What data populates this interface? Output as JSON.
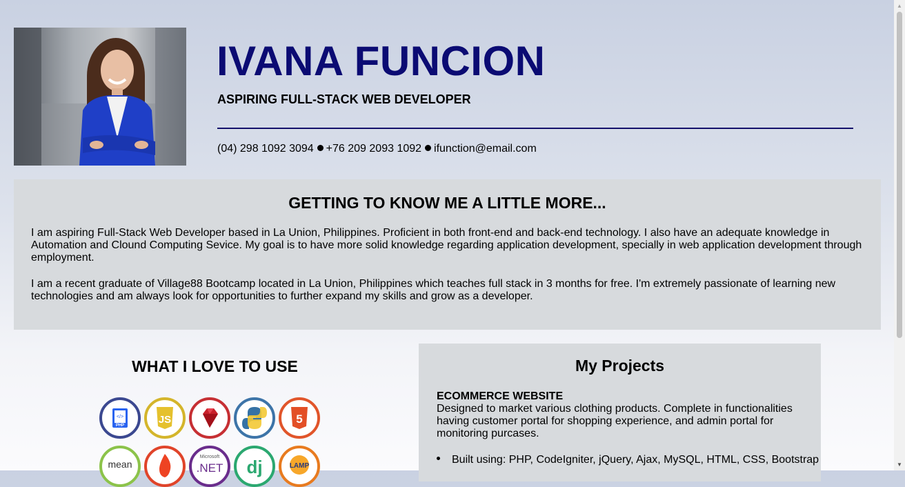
{
  "header": {
    "name": "IVANA FUNCION",
    "role": "ASPIRING FULL-STACK WEB DEVELOPER",
    "phone1": "(04) 298 1092 3094",
    "phone2": "+76 209 2093 1092",
    "email": "ifunction@email.com"
  },
  "about": {
    "title": "GETTING TO KNOW ME A LITTLE MORE...",
    "paragraph1": "I am aspiring Full-Stack Web Developer based in La Union, Philippines. Proficient in both front-end and back-end technology. I also have an adequate knowledge in Automation and Clound Computing Sevice. My goal is to have more solid knowledge regarding application development, specially in web application development through employment.",
    "paragraph2": "I am a recent graduate of Village88 Bootcamp located in La Union, Philippines which teaches full stack in 3 months for free. I'm extremely passionate of learning new technologies and am always look for opportunities to further expand my skills and grow as a developer."
  },
  "tools": {
    "title": "WHAT I LOVE TO USE",
    "icons": [
      {
        "name": "php-icon",
        "label": "PHP",
        "color": "#3b4890"
      },
      {
        "name": "javascript-icon",
        "label": "JS",
        "color": "#d4b52b"
      },
      {
        "name": "ruby-icon",
        "label": "",
        "color": "#c62f33"
      },
      {
        "name": "python-icon",
        "label": "",
        "color": "#3d74a8"
      },
      {
        "name": "html5-icon",
        "label": "5",
        "color": "#e1552a"
      },
      {
        "name": "mean-icon",
        "label": "mean",
        "color": "#8cc34a"
      },
      {
        "name": "codeigniter-icon",
        "label": "",
        "color": "#e0442a"
      },
      {
        "name": "dotnet-icon",
        "label": "Microsoft .NET",
        "color": "#6a2d8c"
      },
      {
        "name": "django-icon",
        "label": "dj",
        "color": "#2ba870"
      },
      {
        "name": "lamp-icon",
        "label": "LAMP",
        "color": "#e87b1f"
      }
    ]
  },
  "projects": {
    "title": "My Projects",
    "items": [
      {
        "name": "ECOMMERCE WEBSITE",
        "description": "Designed to market various clothing products. Complete in functionalities having customer portal for shopping experience, and admin portal for monitoring purcases.",
        "built_using": "Built using: PHP, CodeIgniter, jQuery, Ajax, MySQL, HTML, CSS, Bootstrap"
      }
    ]
  }
}
